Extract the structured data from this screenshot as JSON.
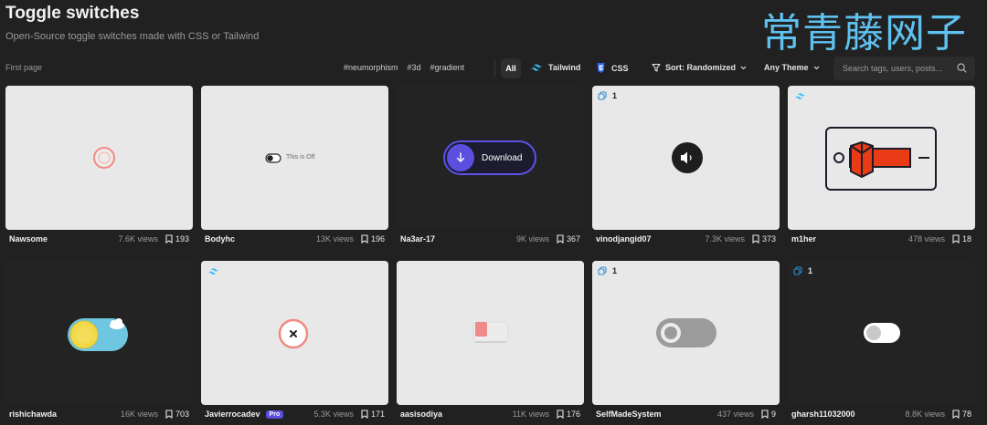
{
  "header": {
    "title": "Toggle switches",
    "subtitle": "Open-Source toggle switches made with CSS or Tailwind",
    "watermark": "常青藤网子"
  },
  "toolbar": {
    "first_page": "First page",
    "tags": [
      "#neumorphism",
      "#3d",
      "#gradient"
    ],
    "all": "All",
    "tailwind": "Tailwind",
    "css": "CSS",
    "sort": "Sort: Randomized",
    "theme": "Any Theme",
    "search_placeholder": "Search tags, users, posts..."
  },
  "cards": [
    {
      "author": "Nawsome",
      "views": "7.6K views",
      "saves": "193",
      "theme": "light"
    },
    {
      "author": "Bodyhc",
      "views": "13K views",
      "saves": "196",
      "theme": "light",
      "toggle_text": "This is Off"
    },
    {
      "author": "Na3ar-17",
      "views": "9K views",
      "saves": "367",
      "theme": "dark",
      "button_label": "Download"
    },
    {
      "author": "vinodjangid07",
      "views": "7.3K views",
      "saves": "373",
      "theme": "light",
      "badge_count": "1"
    },
    {
      "author": "m1her",
      "views": "478 views",
      "saves": "18",
      "theme": "light"
    },
    {
      "author": "rishichawda",
      "views": "16K views",
      "saves": "703",
      "theme": "dark"
    },
    {
      "author": "Javierrocadev",
      "views": "5.3K views",
      "saves": "171",
      "theme": "light",
      "pro": "Pro"
    },
    {
      "author": "aasisodiya",
      "views": "11K views",
      "saves": "176",
      "theme": "light"
    },
    {
      "author": "SelfMadeSystem",
      "views": "437 views",
      "saves": "9",
      "theme": "light",
      "badge_count": "1"
    },
    {
      "author": "gharsh11032000",
      "views": "8.8K views",
      "saves": "78",
      "theme": "dark",
      "badge_count": "1"
    }
  ],
  "colors": {
    "background": "#212121",
    "card_light": "#e8e8e8",
    "card_dark": "#232323",
    "accent_purple": "#5b4fe0",
    "tailwind_blue": "#38bdf8"
  }
}
